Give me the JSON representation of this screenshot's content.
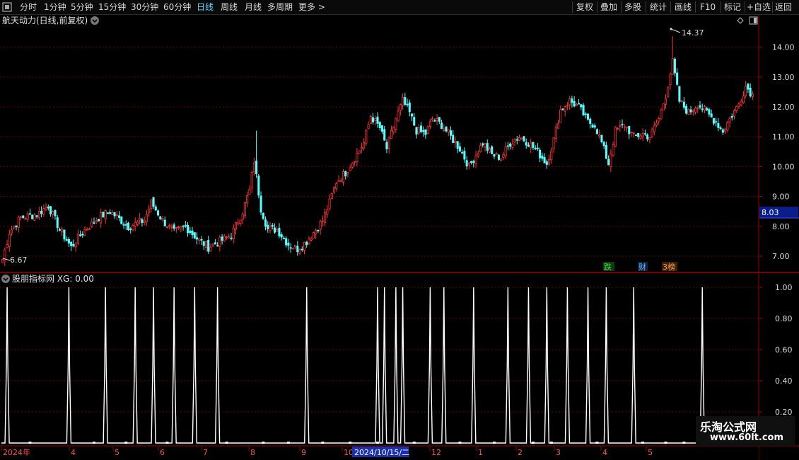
{
  "toolbar": {
    "icon": "window-icon",
    "left_items": [
      "分时",
      "1分钟",
      "5分钟",
      "15分钟",
      "30分钟",
      "60分钟",
      "日线",
      "周线",
      "月线",
      "多周期",
      "更多 >"
    ],
    "active": "日线",
    "right_items": [
      "复权",
      "叠加",
      "多股",
      "统计",
      "画线",
      "F10",
      "标记",
      "+自选",
      "返回"
    ]
  },
  "price_panel": {
    "title": "航天动力(日线,前复权)",
    "current_price": "8.03",
    "max_label": "14.37",
    "min_label": "6.67",
    "y_labels": [
      "14.00",
      "13.00",
      "12.00",
      "11.00",
      "10.00",
      "9.00",
      "8.00",
      "7.00"
    ],
    "badges": [
      "跌",
      "财",
      "3榜"
    ],
    "colors": {
      "up": "#ff3232",
      "down": "#54ffff",
      "grid": "#6a0000",
      "axis": "#a00000",
      "price_tag": "#0b1d8a",
      "badge_green": "#4ce04c",
      "badge_blue": "#69b6ff",
      "badge_orange": "#ff9a3c"
    }
  },
  "indicator_panel": {
    "title": "股朋指标网 XG: 0.00",
    "y_labels": [
      "1.00",
      "0.80",
      "0.60",
      "0.40",
      "0.20"
    ]
  },
  "date_axis": {
    "labels": [
      "2024年",
      "4",
      "5",
      "6",
      "7",
      "8",
      "9",
      "10",
      "2024/10/15/二",
      "12",
      "1",
      "2",
      "3",
      "4",
      "5"
    ]
  },
  "watermark": {
    "line1": "乐淘公式网",
    "line2": "www.60lt.com"
  },
  "chart_data": {
    "type": "candlestick",
    "ylim": [
      6.55,
      14.75
    ],
    "anchors": [
      [
        0,
        6.9
      ],
      [
        3,
        7.8
      ],
      [
        8,
        8.3
      ],
      [
        15,
        8.4
      ],
      [
        20,
        8.7
      ],
      [
        25,
        7.9
      ],
      [
        30,
        7.3
      ],
      [
        35,
        7.8
      ],
      [
        42,
        8.3
      ],
      [
        47,
        8.5
      ],
      [
        55,
        8.0
      ],
      [
        62,
        8.2
      ],
      [
        65,
        8.8
      ],
      [
        70,
        8.2
      ],
      [
        75,
        7.8
      ],
      [
        80,
        8.0
      ],
      [
        85,
        7.6
      ],
      [
        90,
        7.3
      ],
      [
        95,
        7.5
      ],
      [
        100,
        7.7
      ],
      [
        105,
        8.5
      ],
      [
        108,
        9.2
      ],
      [
        110,
        10.2
      ],
      [
        113,
        8.6
      ],
      [
        116,
        7.9
      ],
      [
        120,
        7.9
      ],
      [
        125,
        7.4
      ],
      [
        129,
        7.25
      ],
      [
        133,
        7.5
      ],
      [
        137,
        7.9
      ],
      [
        140,
        8.2
      ],
      [
        143,
        8.8
      ],
      [
        146,
        9.5
      ],
      [
        150,
        9.8
      ],
      [
        154,
        10.3
      ],
      [
        158,
        10.8
      ],
      [
        161,
        11.7
      ],
      [
        165,
        11.3
      ],
      [
        168,
        10.6
      ],
      [
        172,
        11.6
      ],
      [
        175,
        12.2
      ],
      [
        178,
        11.8
      ],
      [
        181,
        11.2
      ],
      [
        185,
        11.1
      ],
      [
        188,
        11.6
      ],
      [
        192,
        11.4
      ],
      [
        196,
        11.0
      ],
      [
        200,
        10.6
      ],
      [
        204,
        10.0
      ],
      [
        207,
        10.4
      ],
      [
        210,
        10.8
      ],
      [
        214,
        10.4
      ],
      [
        218,
        10.3
      ],
      [
        222,
        10.8
      ],
      [
        226,
        11.0
      ],
      [
        230,
        10.8
      ],
      [
        234,
        10.5
      ],
      [
        238,
        10.1
      ],
      [
        241,
        10.9
      ],
      [
        244,
        11.9
      ],
      [
        248,
        12.2
      ],
      [
        252,
        12.0
      ],
      [
        256,
        11.5
      ],
      [
        259,
        11.4
      ],
      [
        262,
        10.8
      ],
      [
        265,
        10.1
      ],
      [
        268,
        11.2
      ],
      [
        272,
        11.4
      ],
      [
        276,
        11.0
      ],
      [
        280,
        11.1
      ],
      [
        283,
        11.0
      ],
      [
        287,
        11.6
      ],
      [
        290,
        12.4
      ],
      [
        293,
        13.5
      ],
      [
        296,
        12.2
      ],
      [
        300,
        11.8
      ],
      [
        304,
        12.1
      ],
      [
        308,
        11.8
      ],
      [
        312,
        11.5
      ],
      [
        315,
        11.2
      ],
      [
        318,
        11.6
      ],
      [
        322,
        12.1
      ],
      [
        325,
        12.7
      ],
      [
        328,
        12.4
      ]
    ],
    "special_bars": [
      [
        111,
        "wick",
        11.2
      ],
      [
        293,
        "wick",
        14.37
      ],
      [
        1,
        "wick",
        6.67
      ]
    ],
    "xg_signals": [
      2,
      29,
      45,
      58,
      66,
      75,
      84,
      94,
      133,
      164,
      167,
      172,
      175,
      187,
      193,
      206,
      221,
      230,
      238,
      247,
      256,
      264,
      276,
      306
    ],
    "xg_small_dots": [
      12,
      40,
      54,
      72,
      98,
      114,
      125,
      140,
      152,
      164,
      180,
      200,
      215,
      232,
      240,
      260,
      280,
      290,
      298,
      314
    ]
  }
}
